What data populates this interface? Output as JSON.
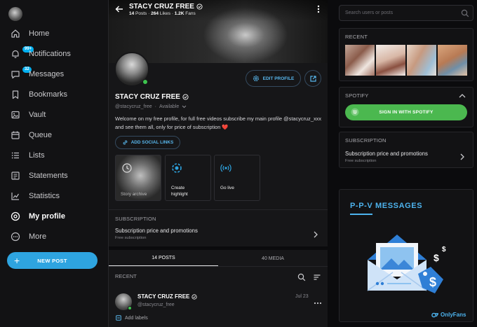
{
  "sidebar": {
    "items": [
      {
        "label": "Home",
        "icon": "home-icon"
      },
      {
        "label": "Notifications",
        "icon": "bell-icon",
        "badge": "99+"
      },
      {
        "label": "Messages",
        "icon": "chat-icon",
        "badge": "32"
      },
      {
        "label": "Bookmarks",
        "icon": "bookmark-icon"
      },
      {
        "label": "Vault",
        "icon": "vault-icon"
      },
      {
        "label": "Queue",
        "icon": "calendar-icon"
      },
      {
        "label": "Lists",
        "icon": "list-icon"
      },
      {
        "label": "Statements",
        "icon": "statements-icon"
      },
      {
        "label": "Statistics",
        "icon": "chart-icon"
      },
      {
        "label": "My profile",
        "icon": "profile-icon",
        "active": true
      },
      {
        "label": "More",
        "icon": "more-icon"
      }
    ],
    "new_post_label": "NEW POST"
  },
  "header": {
    "name": "STACY CRUZ FREE",
    "posts_count": "14",
    "posts_word": "Posts",
    "likes_count": "264",
    "likes_word": "Likes",
    "fans_count": "1.2K",
    "fans_word": "Fans"
  },
  "profile": {
    "name": "STACY CRUZ FREE",
    "handle": "@stacycruz_free",
    "status": "Available",
    "bio": "Welcome on my free profile, for full free videos subscribe my main profile @stacycruz_xxx and see them all, only for price of subscription ❤️",
    "edit_label": "EDIT PROFILE",
    "social_label": "ADD SOCIAL LINKS",
    "tiles": {
      "story": "Story archive",
      "highlight_l1": "Create",
      "highlight_l2": "highlight",
      "live": "Go live"
    }
  },
  "subscription": {
    "title": "SUBSCRIPTION",
    "row_title": "Subscription price and promotions",
    "row_sub": "Free subscription"
  },
  "tabs": [
    "14 POSTS",
    "40 MEDIA"
  ],
  "recent_label": "RECENT",
  "post": {
    "name": "STACY CRUZ FREE",
    "handle": "@stacycruz_free",
    "date": "Jul 23",
    "add_labels": "Add labels"
  },
  "right": {
    "search_placeholder": "Search users or posts",
    "recent_title": "RECENT",
    "spotify_title": "SPOTIFY",
    "spotify_button": "SIGN IN WITH SPOTIFY",
    "sub_title": "SUBSCRIPTION",
    "sub_row": "Subscription price and promotions",
    "sub_row_sub": "Free subscription",
    "ad_title": "P-P-V  MESSAGES",
    "ad_brand": "OnlyFans"
  },
  "colors": {
    "accent": "#00aff0",
    "spotify": "#4bb84f",
    "online": "#3ec54e"
  }
}
